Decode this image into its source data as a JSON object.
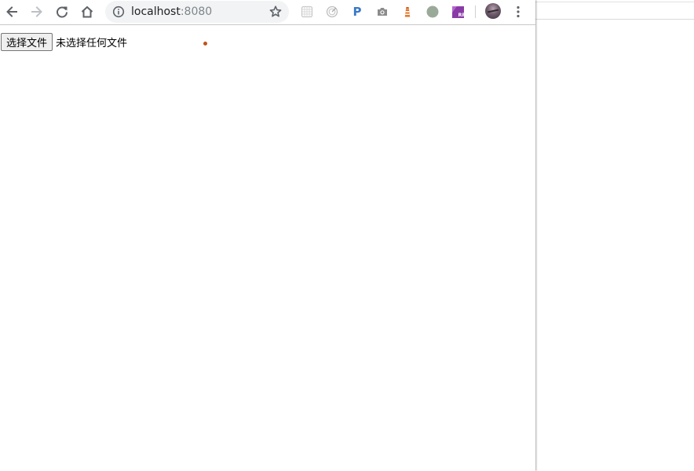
{
  "toolbar": {
    "url_host": "localhost",
    "url_port": ":8080",
    "extensions": [
      "ext-grid-icon",
      "ext-target-icon",
      "ext-p-icon",
      "ext-camera-icon",
      "ext-lighthouse-icon",
      "ext-circle-icon",
      "ext-rp-icon"
    ],
    "ext_p_label": "P",
    "ext_rp_label": "RP"
  },
  "page": {
    "file_button_label": "选择文件",
    "file_status": "未选择任何文件"
  },
  "colors": {
    "omnibox_bg": "#f1f3f4",
    "port_text": "#80868b",
    "ext_p": "#3a78c8",
    "ext_lighthouse": "#d7561f",
    "ext_circle": "#9aaa98",
    "ext_rp": "#8a3aa6",
    "cursor_dot": "#c0541a"
  }
}
